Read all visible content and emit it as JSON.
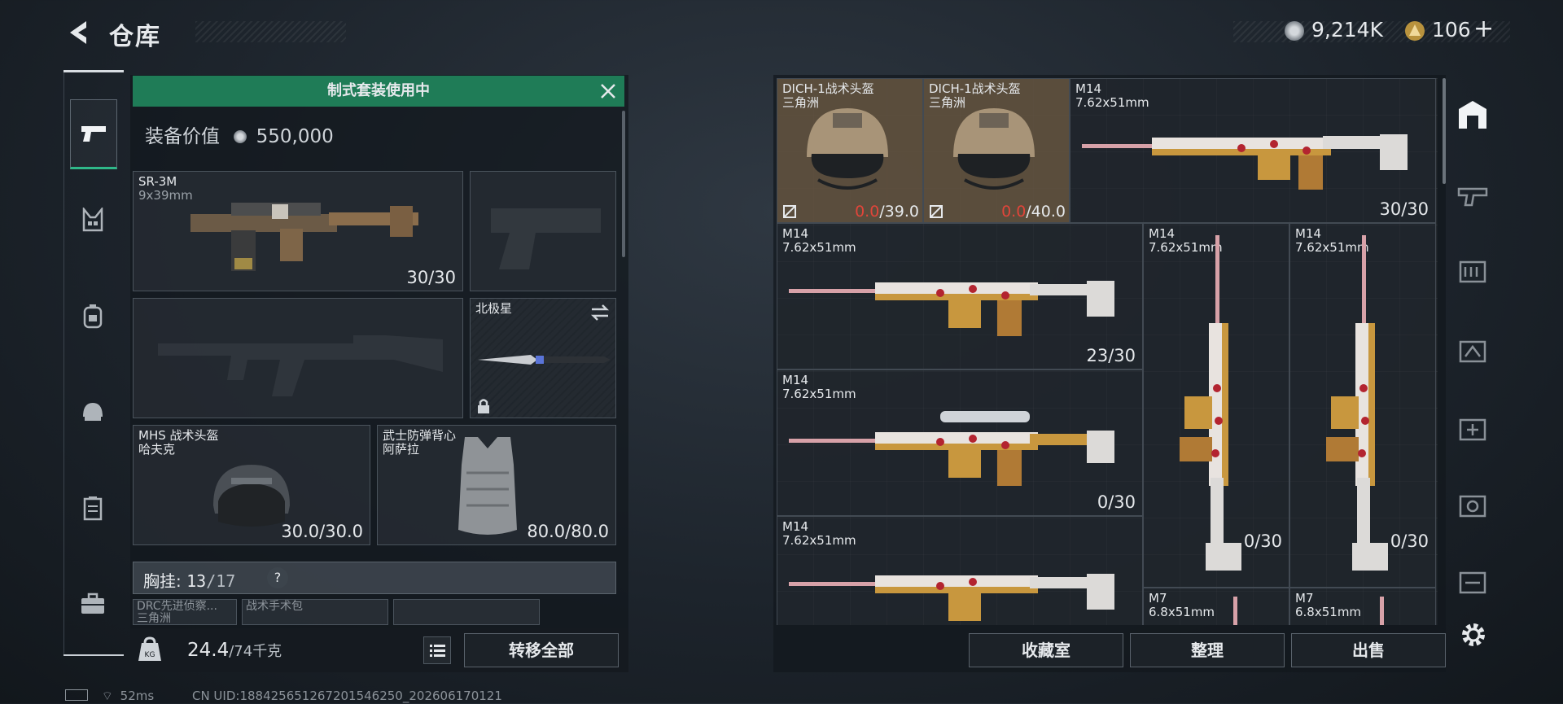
{
  "header": {
    "title": "仓库"
  },
  "currency": {
    "coins": "9,214K",
    "tickets": "106",
    "add_label": "+"
  },
  "rail": {
    "items": [
      {
        "name": "tab-weapons",
        "icon": "pistol-icon",
        "active": true
      },
      {
        "name": "tab-chest-rig",
        "icon": "chest-rig-icon"
      },
      {
        "name": "tab-backpack",
        "icon": "backpack-icon"
      },
      {
        "name": "tab-helmet",
        "icon": "helmet-icon"
      },
      {
        "name": "tab-armor",
        "icon": "armor-icon"
      },
      {
        "name": "tab-case",
        "icon": "case-icon"
      }
    ]
  },
  "loadout": {
    "banner": "制式套装使用中",
    "value_label": "装备价值",
    "value": "550,000",
    "primary": {
      "name": "SR-3M",
      "caliber": "9x39mm",
      "ammo": "30/30"
    },
    "melee": {
      "name": "北极星"
    },
    "helmet": {
      "name": "MHS 战术头盔",
      "origin": "哈夫克",
      "durability": "30.0/30.0"
    },
    "armor": {
      "name": "武士防弹背心",
      "origin": "阿萨拉",
      "durability": "80.0/80.0"
    },
    "chest": {
      "label": "胸挂:",
      "used": "13",
      "capacity": "/17",
      "help": "?"
    },
    "chest_items": [
      {
        "name": "DRC先进侦察...",
        "origin": "三角洲"
      },
      {
        "name": "战术手术包",
        "origin": ""
      },
      {
        "name": "",
        "origin": ""
      }
    ],
    "weight": "24.4",
    "weight_max": "/74千克",
    "transfer_all": "转移全部"
  },
  "storage": {
    "items": [
      {
        "name": "DICH-1战术头盔",
        "sub": "三角洲",
        "dur_cur": "0.0",
        "dur_max": "/39.0"
      },
      {
        "name": "DICH-1战术头盔",
        "sub": "三角洲",
        "dur_cur": "0.0",
        "dur_max": "/40.0"
      },
      {
        "name": "M14",
        "sub": "7.62x51mm",
        "ammo": "30/30"
      },
      {
        "name": "M14",
        "sub": "7.62x51mm",
        "ammo": "23/30"
      },
      {
        "name": "M14",
        "sub": "7.62x51mm",
        "ammo": "0/30"
      },
      {
        "name": "M14",
        "sub": "7.62x51mm",
        "ammo": "0/30"
      },
      {
        "name": "M14",
        "sub": "7.62x51mm",
        "ammo": "0/30"
      },
      {
        "name": "M14",
        "sub": "7.62x51mm",
        "ammo": ""
      },
      {
        "name": "M7",
        "sub": "6.8x51mm",
        "ammo": ""
      },
      {
        "name": "M7",
        "sub": "6.8x51mm",
        "ammo": ""
      }
    ],
    "buttons": {
      "collection": "收藏室",
      "sort": "整理",
      "sell": "出售"
    }
  },
  "status_bar": {
    "ping": "52ms",
    "uid": "CN UID:18842565126720154​6250_202606170121"
  },
  "colors": {
    "accent_green": "#1f7c57",
    "alert_red": "#e0453a",
    "gold": "#c8973e"
  }
}
